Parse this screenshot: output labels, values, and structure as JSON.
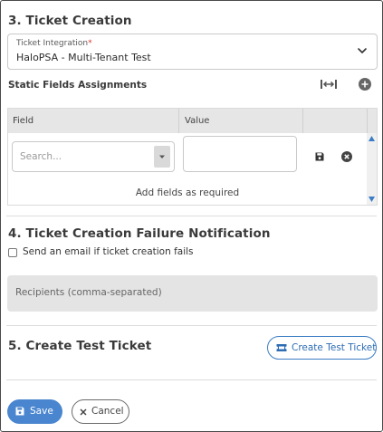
{
  "ticket_creation": {
    "title": "3. Ticket Creation",
    "integration": {
      "label": "Ticket Integration",
      "required_mark": "*",
      "value": "HaloPSA - Multi-Tenant Test"
    },
    "static_fields": {
      "label": "Static Fields Assignments",
      "columns": [
        "Field",
        "Value"
      ],
      "row": {
        "field_placeholder": "Search...",
        "value": ""
      },
      "footer": "Add fields as required"
    }
  },
  "failure_notification": {
    "title": "4. Ticket Creation Failure Notification",
    "checkbox_label": "Send an email if ticket creation fails",
    "checked": false,
    "recipients_placeholder": "Recipients (comma-separated)"
  },
  "test_ticket": {
    "title": "5. Create Test Ticket",
    "button_label": "Create Test Ticket"
  },
  "actions": {
    "save_label": "Save",
    "cancel_label": "Cancel"
  },
  "colors": {
    "primary": "#4a86cf",
    "outline_blue": "#3b7dc4",
    "required": "#d9342b"
  },
  "icons": [
    "chevron-down-icon",
    "expand-horizontal-icon",
    "add-circle-icon",
    "dropdown-arrow-icon",
    "save-icon",
    "remove-circle-icon",
    "scroll-up-icon",
    "scroll-down-icon",
    "ticket-icon",
    "close-icon"
  ]
}
